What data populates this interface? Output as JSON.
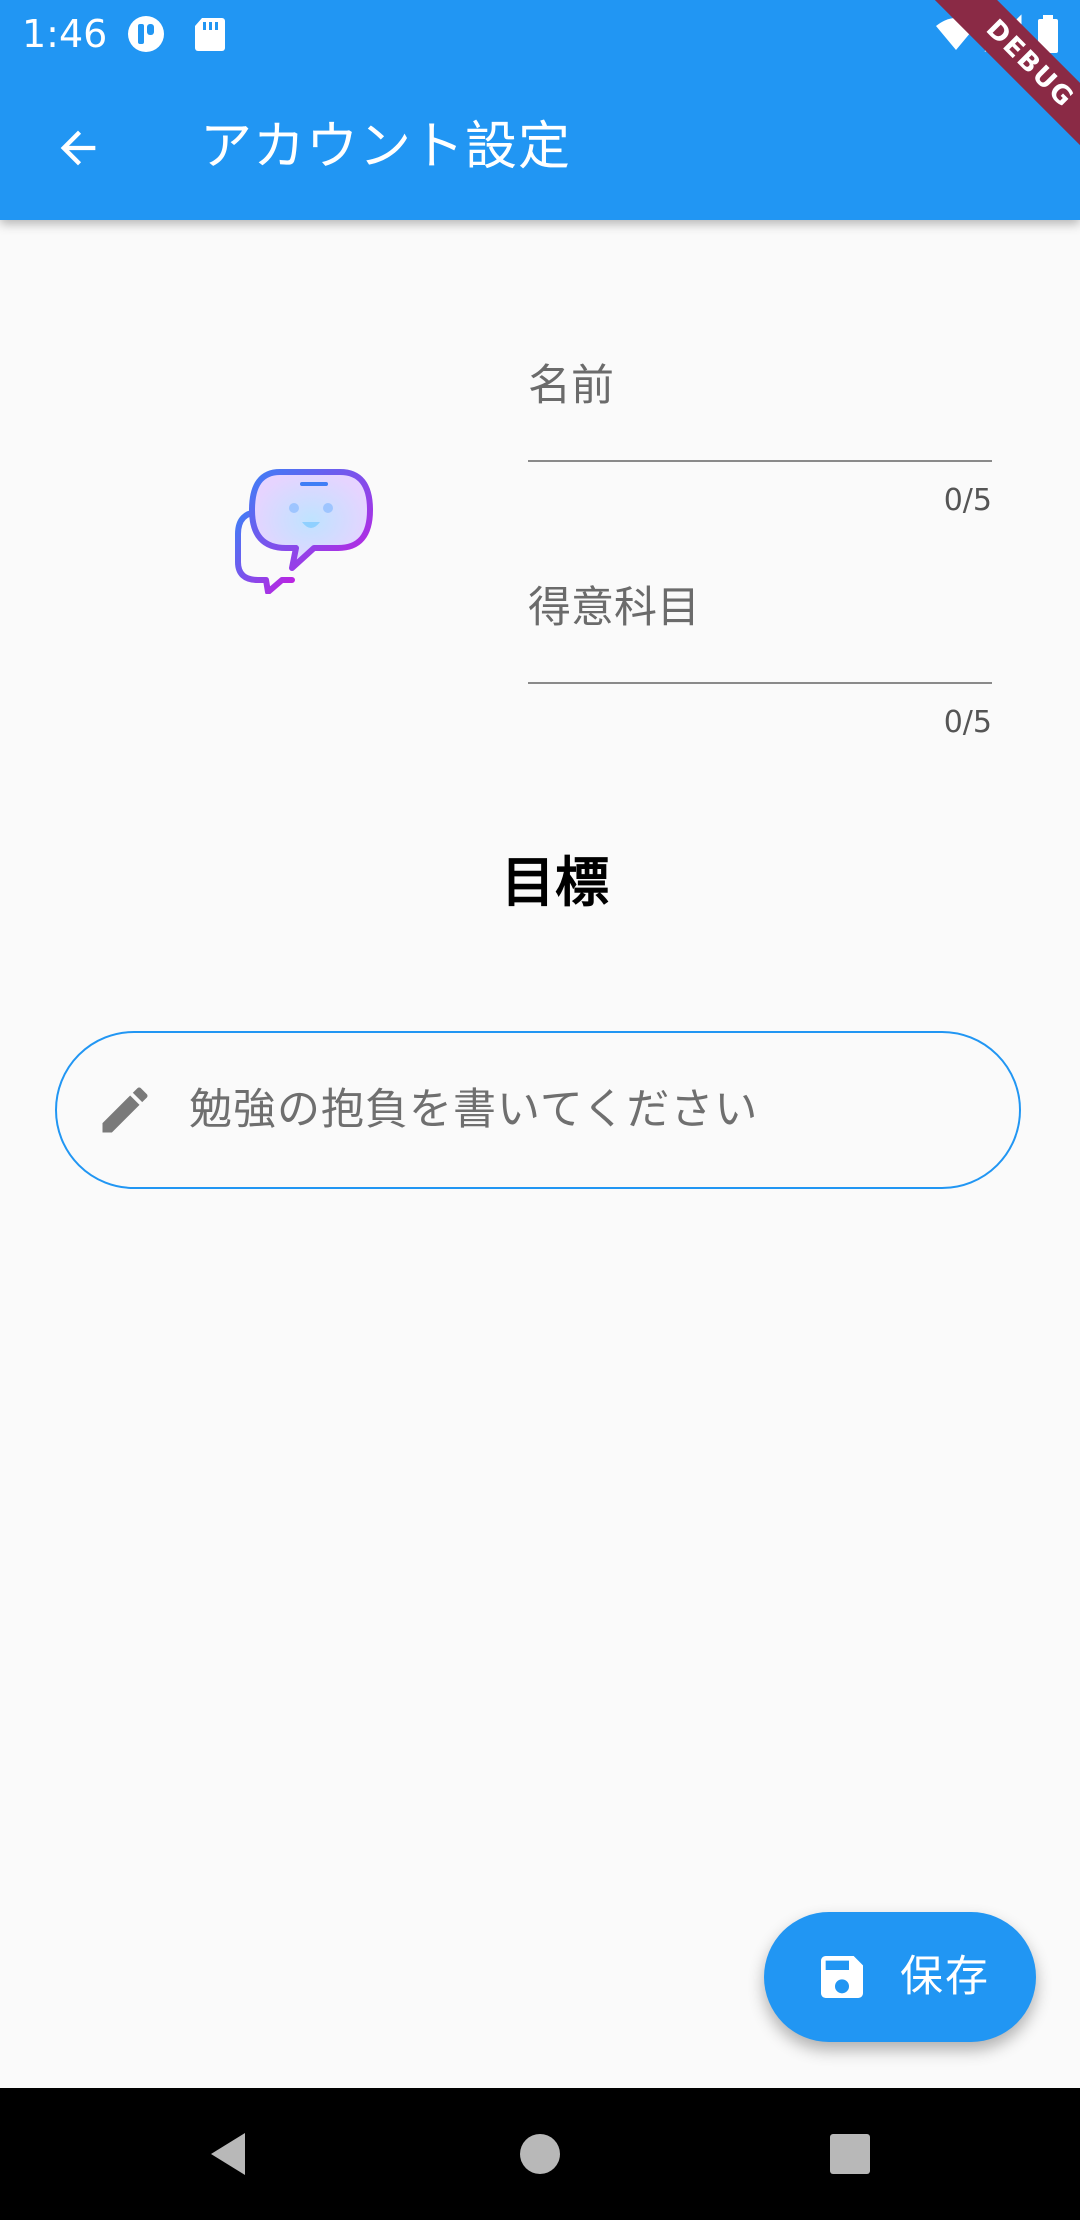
{
  "status_bar": {
    "time": "1:46",
    "icons": [
      "notification-app-icon",
      "sd-card-icon",
      "wifi-icon",
      "signal-icon",
      "battery-icon"
    ]
  },
  "app_bar": {
    "title": "アカウント設定",
    "back_icon": "arrow-back-icon",
    "background": "#2196f3",
    "debug_banner": "DEBUG"
  },
  "profile": {
    "avatar_icon": "chat-bubble-face-icon",
    "name_field": {
      "label": "名前",
      "value": "",
      "counter": "0/5"
    },
    "subject_field": {
      "label": "得意科目",
      "value": "",
      "counter": "0/5"
    }
  },
  "goal": {
    "heading": "目標",
    "input_icon": "pencil-icon",
    "placeholder": "勉強の抱負を書いてください"
  },
  "fab": {
    "icon": "save-icon",
    "label": "保存"
  },
  "nav_bar": {
    "buttons": [
      "back-triangle-icon",
      "home-circle-icon",
      "recents-square-icon"
    ]
  },
  "colors": {
    "primary": "#2196f3",
    "background": "#fafafa",
    "debug_ribbon": "#8a2a45"
  }
}
